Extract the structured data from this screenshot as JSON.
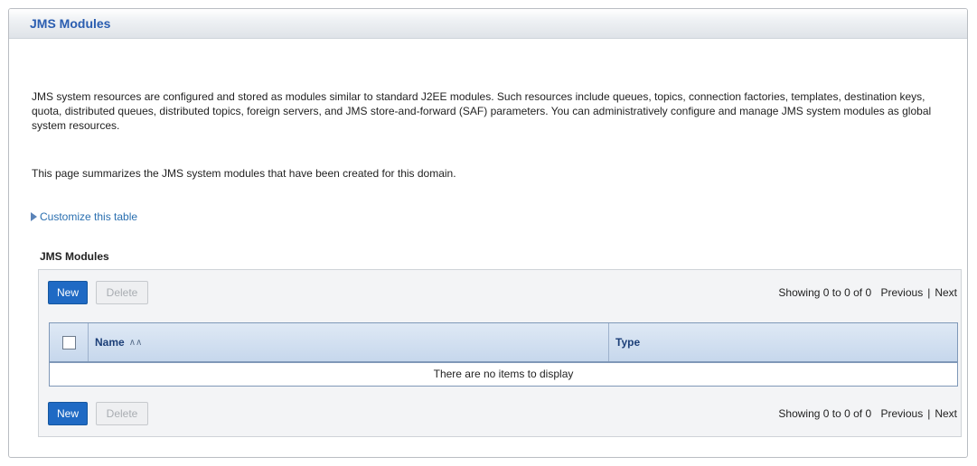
{
  "panel": {
    "title": "JMS Modules"
  },
  "description": {
    "paragraph1": "JMS system resources are configured and stored as modules similar to standard J2EE modules. Such resources include queues, topics, connection factories, templates, destination keys, quota, distributed queues, distributed topics, foreign servers, and JMS store-and-forward (SAF) parameters. You can administratively configure and manage JMS system modules as global system resources.",
    "paragraph2": "This page summarizes the JMS system modules that have been created for this domain."
  },
  "customize": {
    "label": "Customize this table",
    "icon": "expand-triangle-icon"
  },
  "table": {
    "caption": "JMS Modules",
    "new_label": "New",
    "delete_label": "Delete",
    "paging": {
      "showing": "Showing 0 to 0 of 0",
      "previous": "Previous",
      "separator": "|",
      "next": "Next"
    },
    "columns": [
      "Name",
      "Type"
    ],
    "sort_icon": "sort-ascending-icon",
    "empty_message": "There are no items to display"
  },
  "colors": {
    "accent": "#2a5db0",
    "button": "#1f6ac4",
    "header_bg": "#c6d7ec"
  }
}
